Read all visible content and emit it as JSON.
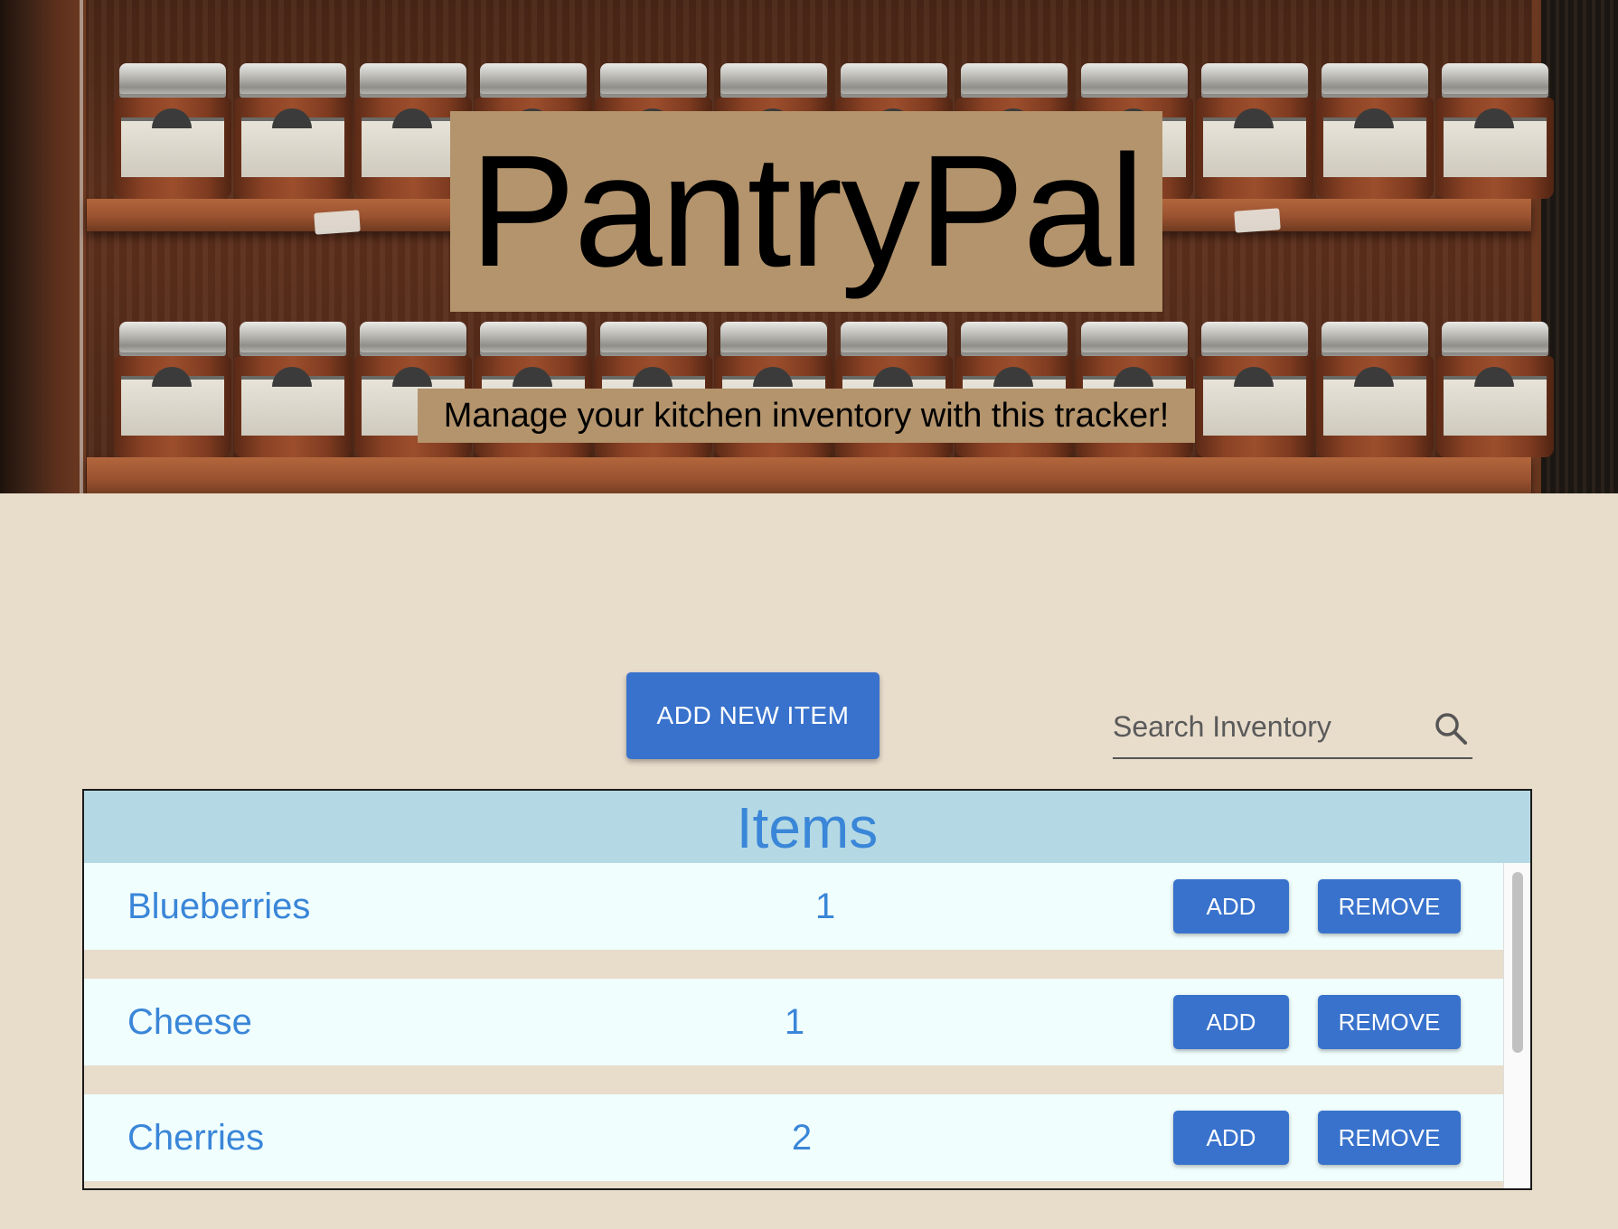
{
  "hero": {
    "title": "PantryPal",
    "subtitle": "Manage your kitchen inventory with this tracker!"
  },
  "controls": {
    "add_new_label": "ADD NEW ITEM",
    "search_placeholder": "Search Inventory",
    "search_icon": "search-icon"
  },
  "table": {
    "title": "Items",
    "add_label": "ADD",
    "remove_label": "REMOVE",
    "items": [
      {
        "name": "Blueberries",
        "quantity": "1"
      },
      {
        "name": "Cheese",
        "quantity": "1"
      },
      {
        "name": "Cherries",
        "quantity": "2"
      }
    ]
  },
  "colors": {
    "page_background": "#e8dccb",
    "banner_box": "#b4946c",
    "button_blue": "#3872cc",
    "table_header": "#b5d9e4",
    "item_text": "#3a86d8",
    "row_background": "#f0fefe"
  }
}
